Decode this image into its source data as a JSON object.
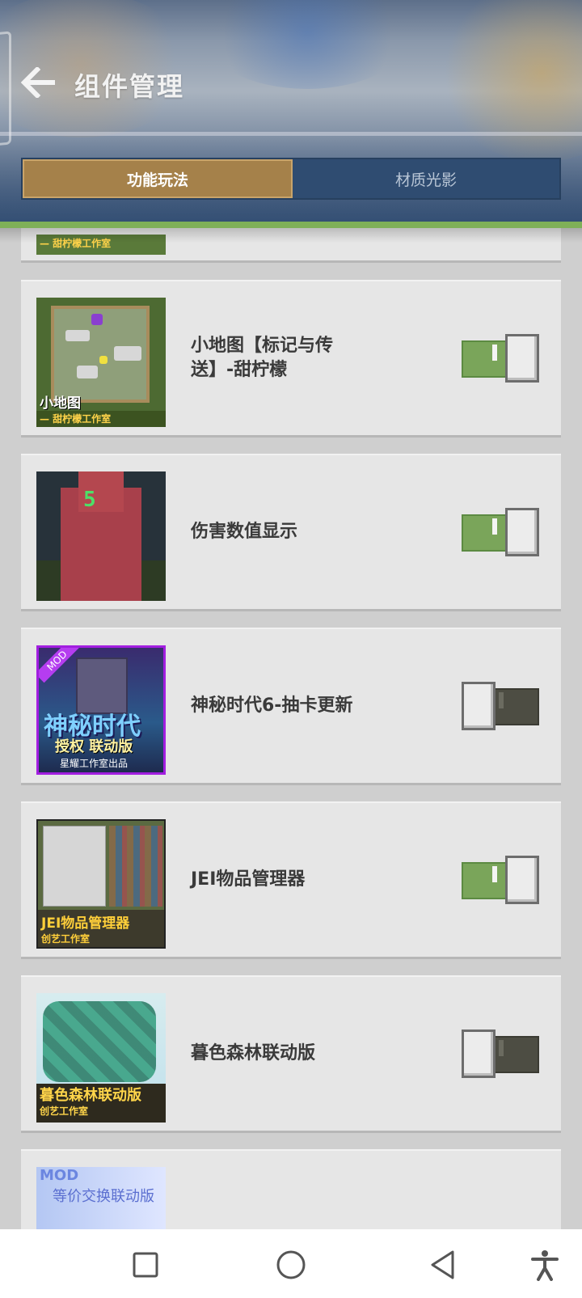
{
  "header": {
    "title": "组件管理",
    "back_icon": "arrow-left-icon",
    "tabs": [
      {
        "label": "功能玩法",
        "active": true
      },
      {
        "label": "材质光影",
        "active": false
      }
    ]
  },
  "list": {
    "partial_top": {
      "thumb_text": "— 甜柠檬工作室"
    },
    "items": [
      {
        "name": "小地图【标记与传送】-甜柠檬",
        "enabled": true,
        "thumb_text": [
          "小地图",
          "— 甜柠檬工作室"
        ]
      },
      {
        "name": "伤害数值显示",
        "enabled": true,
        "thumb_text": [
          "5"
        ]
      },
      {
        "name": "神秘时代6-抽卡更新",
        "enabled": false,
        "thumb_text": [
          "MOD",
          "神秘时代",
          "授权 联动版",
          "星耀工作室出品"
        ]
      },
      {
        "name": "JEI物品管理器",
        "enabled": true,
        "thumb_text": [
          "JEI物品管理器",
          "创艺工作室"
        ]
      },
      {
        "name": "暮色森林联动版",
        "enabled": false,
        "thumb_text": [
          "暮色森林联动版",
          "创艺工作室"
        ]
      }
    ],
    "partial_bottom": {
      "thumb_text": [
        "MOD",
        "等价交换联动版"
      ]
    }
  },
  "colors": {
    "toggle_on": "#7aa55a",
    "toggle_off": "#4d4d43",
    "tab_active": "#a5814a",
    "tab_inactive": "#2f4c71",
    "accent_strip": "#7fb058"
  },
  "navbar": {
    "icons": [
      "recents-square-icon",
      "home-circle-icon",
      "back-triangle-icon",
      "accessibility-icon"
    ]
  }
}
